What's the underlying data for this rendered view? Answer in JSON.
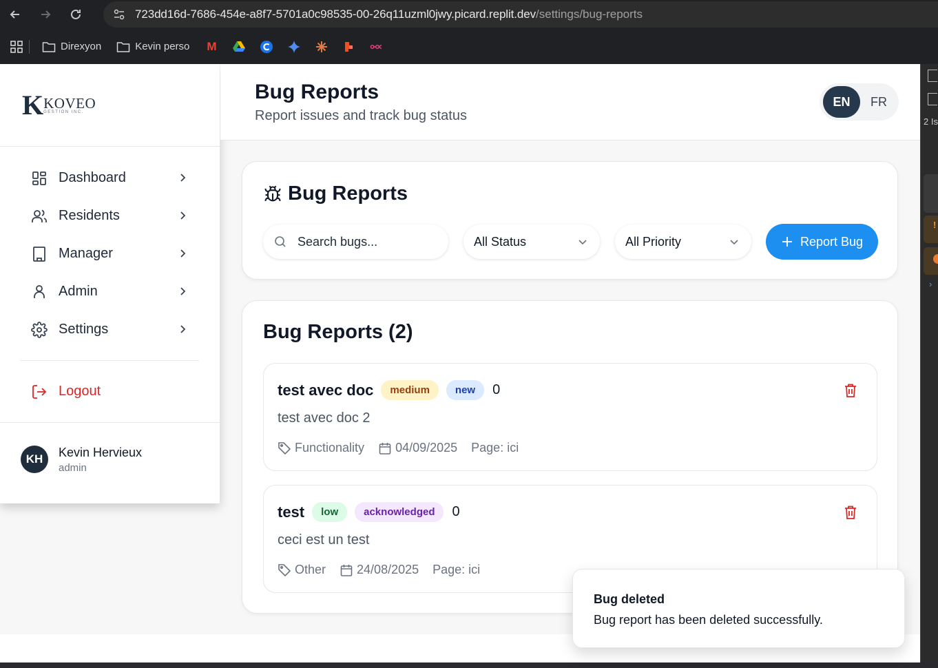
{
  "browser": {
    "url_host": "723dd16d-7686-454e-a8f7-5701a0c98535-00-26q11uzml0jwy.picard.replit.dev",
    "url_path": "/settings/bug-reports",
    "bookmarks": [
      {
        "label": "Direxyon",
        "icon": "folder-icon"
      },
      {
        "label": "Kevin perso",
        "icon": "folder-icon"
      }
    ]
  },
  "devtools": {
    "issues_label": "2 Is"
  },
  "brand": {
    "logo_main": "KOVEO",
    "logo_sub": "GESTION INC.",
    "logo_letter": "K"
  },
  "sidebar": {
    "items": [
      {
        "label": "Dashboard",
        "icon": "dashboard-icon"
      },
      {
        "label": "Residents",
        "icon": "users-icon"
      },
      {
        "label": "Manager",
        "icon": "building-icon"
      },
      {
        "label": "Admin",
        "icon": "user-icon"
      },
      {
        "label": "Settings",
        "icon": "gear-icon"
      }
    ],
    "logout_label": "Logout"
  },
  "user": {
    "initials": "KH",
    "name": "Kevin Hervieux",
    "role": "admin"
  },
  "header": {
    "title": "Bug Reports",
    "subtitle": "Report issues and track bug status",
    "lang_active": "EN",
    "lang_other": "FR"
  },
  "filters": {
    "title": "Bug Reports",
    "search_placeholder": "Search bugs...",
    "status_value": "All Status",
    "priority_value": "All Priority",
    "report_button": "Report Bug"
  },
  "list": {
    "title": "Bug Reports (2)",
    "bugs": [
      {
        "title": "test avec doc",
        "priority": "medium",
        "status": "new",
        "count": "0",
        "description": "test avec doc 2",
        "category": "Functionality",
        "date": "04/09/2025",
        "page": "Page: ici"
      },
      {
        "title": "test",
        "priority": "low",
        "status": "acknowledged",
        "count": "0",
        "description": "ceci est un test",
        "category": "Other",
        "date": "24/08/2025",
        "page": "Page: ici"
      }
    ]
  },
  "toast": {
    "title": "Bug deleted",
    "message": "Bug report has been deleted successfully."
  },
  "colors": {
    "primary": "#1d8ff0",
    "danger": "#dc2626",
    "brand_dark": "#26384c"
  }
}
